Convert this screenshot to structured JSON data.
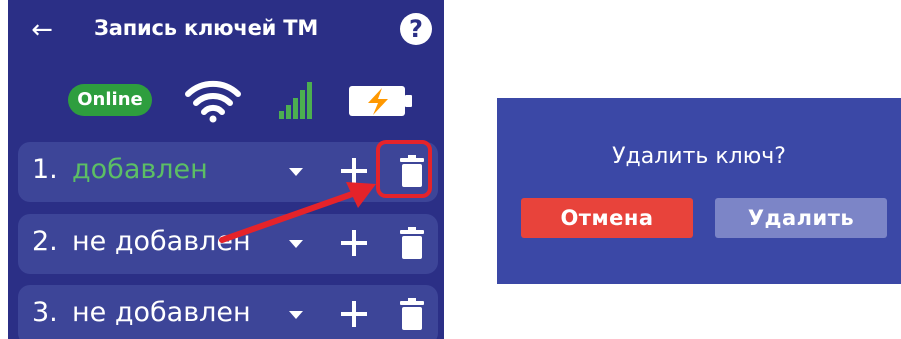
{
  "colors": {
    "panel_bg": "#2b2f86",
    "row_bg": "#3d4598",
    "added_text": "#5cbf64",
    "online_badge": "#2e9e3e",
    "highlight": "#e5232a",
    "dialog_bg": "#3b48a6",
    "cancel_button": "#e8433b",
    "delete_button": "#7c85c7"
  },
  "appbar": {
    "back_icon": "arrow-left-icon",
    "title": "Запись ключей ТМ",
    "help_label": "?"
  },
  "status": {
    "online_label": "Online",
    "icons": [
      "wifi-icon",
      "signal-icon",
      "battery-charging-icon"
    ]
  },
  "keys": [
    {
      "number": "1.",
      "status": "добавлен",
      "added": true
    },
    {
      "number": "2.",
      "status": "не добавлен",
      "added": false
    },
    {
      "number": "3.",
      "status": "не добавлен",
      "added": false
    }
  ],
  "row_icons": {
    "dropdown": "chevron-down-icon",
    "add": "plus-icon",
    "delete": "trash-icon"
  },
  "dialog": {
    "title": "Удалить ключ?",
    "cancel_label": "Отмена",
    "confirm_label": "Удалить"
  }
}
